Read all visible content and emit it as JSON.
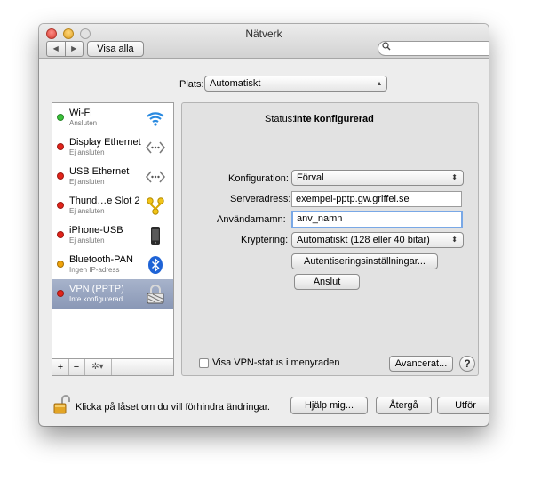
{
  "window": {
    "title": "Nätverk"
  },
  "toolbar": {
    "back_glyph": "◀",
    "forward_glyph": "▶",
    "show_all_label": "Visa alla",
    "search_placeholder": ""
  },
  "location": {
    "label": "Plats:",
    "value": "Automatiskt"
  },
  "services": [
    {
      "name": "Wi-Fi",
      "status": "Ansluten",
      "status_color": "#3ac13a",
      "icon": "wifi-icon"
    },
    {
      "name": "Display Ethernet",
      "status": "Ej ansluten",
      "status_color": "#e2231a",
      "icon": "ethernet-icon"
    },
    {
      "name": "USB Ethernet",
      "status": "Ej ansluten",
      "status_color": "#e2231a",
      "icon": "ethernet-icon"
    },
    {
      "name": "Thund…e Slot 2",
      "status": "Ej ansluten",
      "status_color": "#e2231a",
      "icon": "thunderbolt-icon"
    },
    {
      "name": "iPhone-USB",
      "status": "Ej ansluten",
      "status_color": "#e2231a",
      "icon": "iphone-icon"
    },
    {
      "name": "Bluetooth-PAN",
      "status": "Ingen IP-adress",
      "status_color": "#f0a30a",
      "icon": "bluetooth-icon"
    },
    {
      "name": "VPN (PPTP)",
      "status": "Inte konfigurerad",
      "status_color": "#e2231a",
      "icon": "vpn-lock-icon",
      "selected": true
    }
  ],
  "sidebar_footer": {
    "add": "+",
    "remove": "−",
    "gear": "✲▾"
  },
  "detail": {
    "status_label": "Status:",
    "status_value": "Inte konfigurerad",
    "config_label": "Konfiguration:",
    "config_value": "Förval",
    "server_label": "Serveradress:",
    "server_value": "exempel-pptp.gw.griffel.se",
    "account_label": "Användarnamn:",
    "account_value": "anv_namn",
    "encryption_label": "Kryptering:",
    "encryption_value": "Automatiskt (128 eller 40 bitar)",
    "auth_button": "Autentiseringsinställningar...",
    "connect_button": "Anslut",
    "show_vpn_label": "Visa VPN-status i menyraden",
    "show_vpn_checked": false,
    "advanced_button": "Avancerat...",
    "help_glyph": "?"
  },
  "bottom": {
    "lock_text": "Klicka på låset om du vill förhindra ändringar.",
    "help_button": "Hjälp mig...",
    "revert_button": "Återgå",
    "apply_button": "Utför"
  }
}
